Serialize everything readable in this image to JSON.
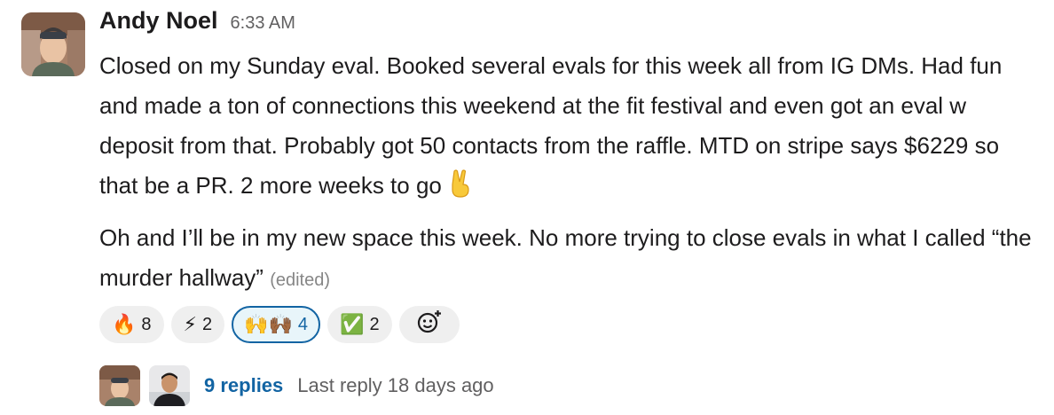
{
  "message": {
    "author": "Andy Noel",
    "time": "6:33 AM",
    "paragraph1": "Closed on my Sunday eval. Booked several evals for this week all from IG DMs. Had fun and made a ton of connections this weekend at the fit festival and even got an eval w deposit from that. Probably got 50 contacts from the raffle. MTD on stripe says $6229 so that be a PR. 2 more weeks to go",
    "paragraph1_emoji": "✌️",
    "paragraph2": "Oh and I’ll be in my new space this week. No more trying to close evals in what I called “the murder hallway”",
    "edited_label": "(edited)"
  },
  "reactions": [
    {
      "emoji": "🔥",
      "count": "8",
      "icon": "fire-icon"
    },
    {
      "emoji": "⚡",
      "count": "2",
      "icon": "lightning-icon"
    },
    {
      "emoji": "🙌🙌🏾",
      "count": "4",
      "icon": "raised-hands-icon",
      "active": true
    },
    {
      "emoji": "✅",
      "count": "2",
      "icon": "check-mark-icon"
    }
  ],
  "thread": {
    "replies_label": "9 replies",
    "last_reply": "Last reply 18 days ago"
  },
  "colors": {
    "link": "#1264a3",
    "muted": "#616061",
    "reaction_bg": "#efefef",
    "reaction_active_bg": "#e8f5fa"
  }
}
